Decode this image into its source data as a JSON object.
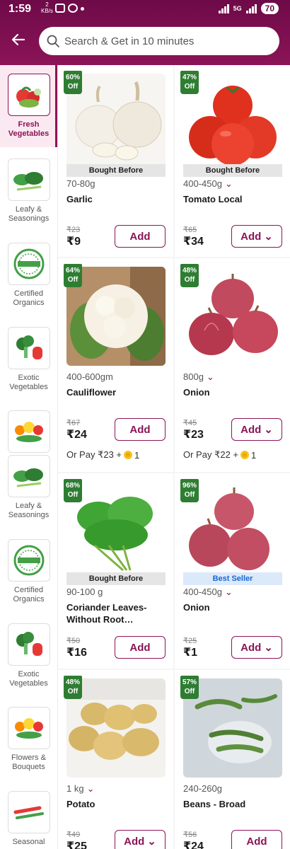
{
  "status": {
    "time": "1:59",
    "net_speed_top": "2",
    "net_speed_bottom": "KB/s",
    "network": "5G",
    "battery": "70"
  },
  "search": {
    "placeholder": "Search & Get in 10 minutes"
  },
  "sidebar": {
    "items": [
      {
        "label": "Fresh Vegetables",
        "active": true
      },
      {
        "label": "Leafy & Seasonings"
      },
      {
        "label": "Certified Organics"
      },
      {
        "label": "Exotic Vegetables"
      },
      {
        "label": ""
      },
      {
        "label": "Leafy & Seasonings"
      },
      {
        "label": "Certified Organics"
      },
      {
        "label": "Exotic Vegetables"
      },
      {
        "label": "Flowers & Bouquets"
      },
      {
        "label": "Seasonal"
      }
    ]
  },
  "products": [
    {
      "discount_pct": "60%",
      "discount_word": "Off",
      "tag": "Bought Before",
      "qty": "70-80g",
      "has_variants": false,
      "name": "Garlic",
      "mrp": "₹23",
      "price": "₹9",
      "add_label": "Add",
      "or_pay": ""
    },
    {
      "discount_pct": "47%",
      "discount_word": "Off",
      "tag": "Bought Before",
      "qty": "400-450g",
      "has_variants": true,
      "name": "Tomato Local",
      "mrp": "₹65",
      "price": "₹34",
      "add_label": "Add",
      "or_pay": ""
    },
    {
      "discount_pct": "64%",
      "discount_word": "Off",
      "tag": "",
      "qty": "400-600gm",
      "has_variants": false,
      "name": "Cauliflower",
      "mrp": "₹67",
      "price": "₹24",
      "add_label": "Add",
      "or_pay": "Or Pay ₹23 +",
      "coins": "1"
    },
    {
      "discount_pct": "48%",
      "discount_word": "Off",
      "tag": "",
      "qty": "800g",
      "has_variants": true,
      "name": "Onion",
      "mrp": "₹45",
      "price": "₹23",
      "add_label": "Add",
      "or_pay": "Or Pay ₹22 +",
      "coins": "1"
    },
    {
      "discount_pct": "68%",
      "discount_word": "Off",
      "tag": "Bought Before",
      "qty": "90-100 g",
      "has_variants": false,
      "name": "Coriander Leaves- Without Root…",
      "mrp": "₹50",
      "price": "₹16",
      "add_label": "Add",
      "or_pay": ""
    },
    {
      "discount_pct": "96%",
      "discount_word": "Off",
      "tag": "Best Seller",
      "qty": "400-450g",
      "has_variants": true,
      "name": "Onion",
      "mrp": "₹25",
      "price": "₹1",
      "add_label": "Add",
      "or_pay": ""
    },
    {
      "discount_pct": "48%",
      "discount_word": "Off",
      "tag": "",
      "qty": "1 kg",
      "has_variants": true,
      "name": "Potato",
      "mrp": "₹49",
      "price": "₹25",
      "add_label": "Add",
      "or_pay": ""
    },
    {
      "discount_pct": "57%",
      "discount_word": "Off",
      "tag": "",
      "qty": "240-260g",
      "has_variants": false,
      "name": "Beans - Broad",
      "mrp": "₹56",
      "price": "₹24",
      "add_label": "Add",
      "or_pay": ""
    }
  ],
  "colors": {
    "brand": "#8b1457",
    "discount": "#2e7d32",
    "best_seller": "#1967d2"
  }
}
